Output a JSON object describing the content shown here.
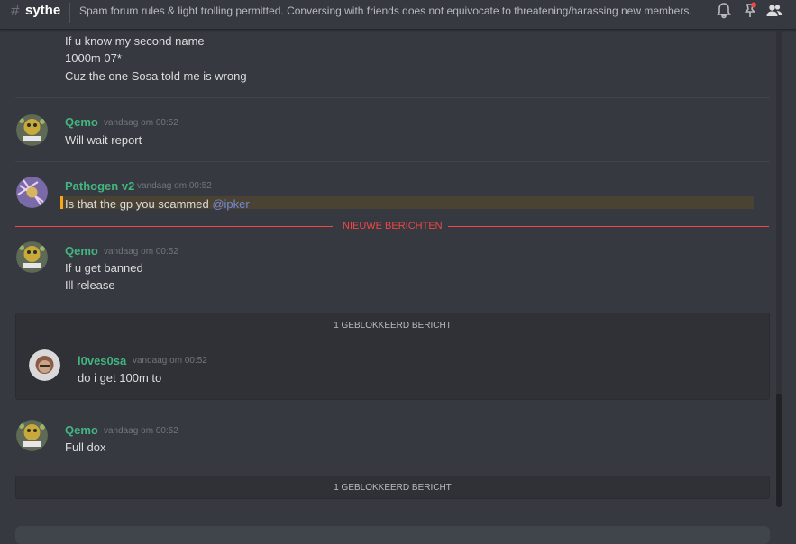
{
  "header": {
    "hash_symbol": "#",
    "channel_name": "sythe",
    "topic": "Spam forum rules & light trolling permitted. Conversing with friends does not equivocate to threatening/harassing new members."
  },
  "icons": {
    "bell": "bell-icon",
    "pin": "pin-icon",
    "members": "members-icon"
  },
  "colors": {
    "author_green": "#43b581",
    "mention_blue": "#7289da",
    "new_messages_red": "#f04747",
    "mention_highlight": "#faa61a"
  },
  "messages": {
    "m0": {
      "lines": [
        "If u know my second name",
        "1000m 07*",
        "Cuz the one Sosa told me is wrong"
      ]
    },
    "m1": {
      "author": "Qemo",
      "timestamp": "vandaag om 00:52",
      "lines": [
        "Will wait report"
      ]
    },
    "m2": {
      "author": "Pathogen v2",
      "timestamp": "vandaag om 00:52",
      "text": "Is that the gp you scammed ",
      "mention": "@ipker"
    },
    "new_messages_label": "NIEUWE BERICHTEN",
    "m3": {
      "author": "Qemo",
      "timestamp": "vandaag om 00:52",
      "lines": [
        "If u get banned",
        "Ill release"
      ]
    },
    "blocked1": {
      "label": "1 GEBLOKKEERD BERICHT",
      "author": "l0ves0sa",
      "timestamp": "vandaag om 00:52",
      "text": "do i get 100m to"
    },
    "m4": {
      "author": "Qemo",
      "timestamp": "vandaag om 00:52",
      "lines": [
        "Full dox"
      ]
    },
    "blocked2": {
      "label": "1 GEBLOKKEERD BERICHT"
    }
  }
}
